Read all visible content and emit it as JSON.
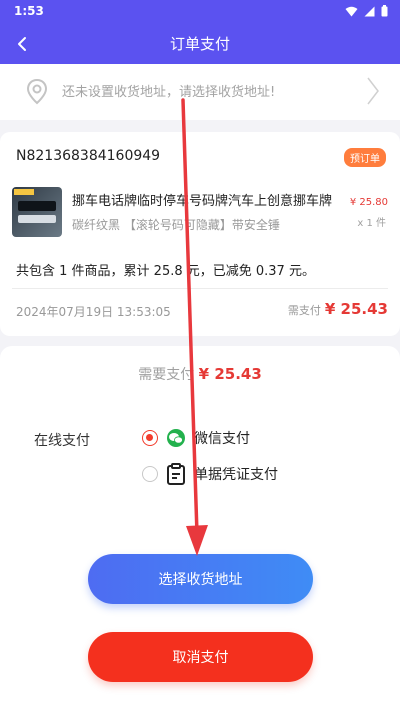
{
  "status_bar": {
    "time": "1:53"
  },
  "nav": {
    "title": "订单支付"
  },
  "address": {
    "placeholder_text": "还未设置收货地址，请选择收货地址!"
  },
  "order": {
    "order_no": "N821368384160949",
    "badge": "预订单",
    "product": {
      "name": "挪车电话牌临时停车号码牌汽车上创意挪车牌",
      "spec": "碳纤纹黑 【滚轮号码可隐藏】带安全锤",
      "price": "¥ 25.80",
      "qty": "x 1 件"
    },
    "summary": "共包含 1 件商品，累计 25.8 元，已减免 0.37 元。",
    "datetime": "2024年07月19日 13:53:05",
    "need_pay_label": "需支付",
    "need_pay_amount": "¥ 25.43"
  },
  "payment": {
    "total_label": "需要支付",
    "total_amount": "¥ 25.43",
    "online_label": "在线支付",
    "methods": [
      {
        "label": "微信支付",
        "selected": true,
        "icon": "wechat-icon"
      },
      {
        "label": "单据凭证支付",
        "selected": false,
        "icon": "clipboard-icon"
      }
    ]
  },
  "buttons": {
    "select_address": "选择收货地址",
    "cancel_pay": "取消支付"
  },
  "colors": {
    "header": "#5b52f0",
    "price_red": "#e53935",
    "badge_orange": "#ff7d3d",
    "primary_blue": "#4e6cf2",
    "cancel_red": "#f4301e",
    "annotation_arrow": "#e8383d"
  }
}
